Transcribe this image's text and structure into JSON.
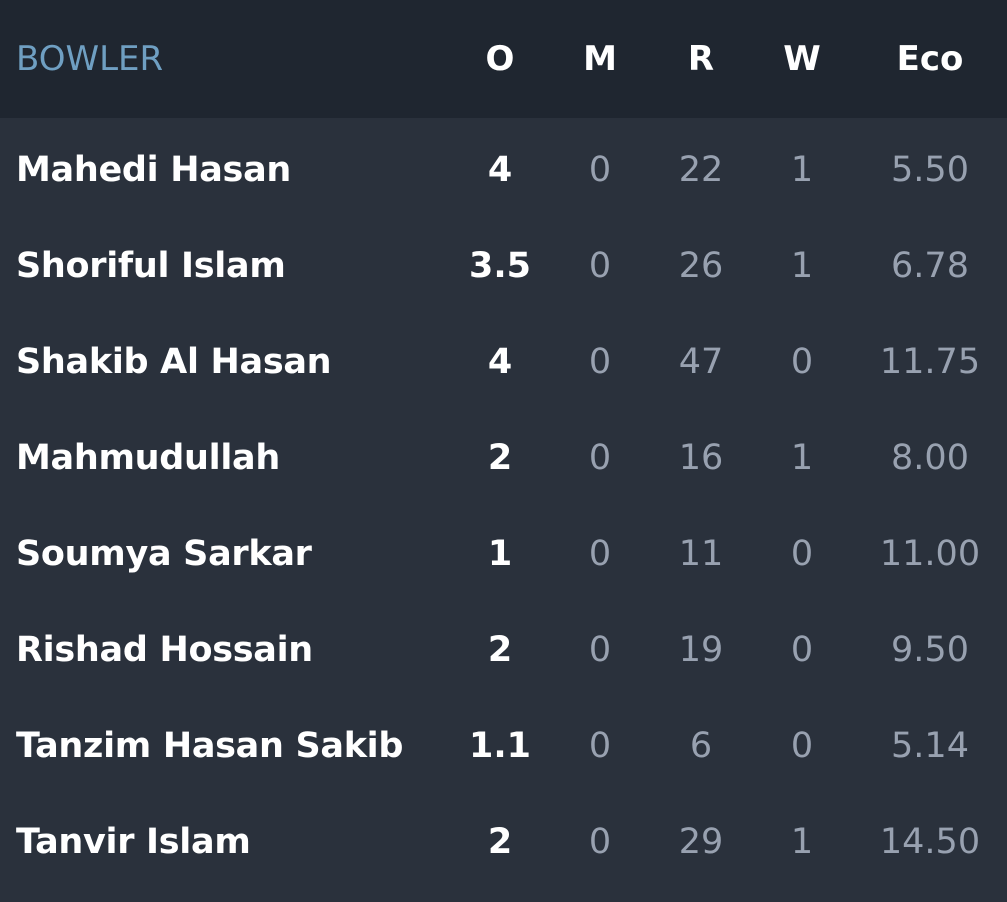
{
  "header": {
    "bowler_label": "BOWLER",
    "overs_label": "O",
    "maidens_label": "M",
    "runs_label": "R",
    "wickets_label": "W",
    "economy_label": "Eco"
  },
  "bowlers": [
    {
      "name": "Mahedi Hasan",
      "overs": "4",
      "maidens": "0",
      "runs": "22",
      "wickets": "1",
      "economy": "5.50"
    },
    {
      "name": "Shoriful Islam",
      "overs": "3.5",
      "maidens": "0",
      "runs": "26",
      "wickets": "1",
      "economy": "6.78"
    },
    {
      "name": "Shakib Al Hasan",
      "overs": "4",
      "maidens": "0",
      "runs": "47",
      "wickets": "0",
      "economy": "11.75"
    },
    {
      "name": "Mahmudullah",
      "overs": "2",
      "maidens": "0",
      "runs": "16",
      "wickets": "1",
      "economy": "8.00"
    },
    {
      "name": "Soumya Sarkar",
      "overs": "1",
      "maidens": "0",
      "runs": "11",
      "wickets": "0",
      "economy": "11.00"
    },
    {
      "name": "Rishad Hossain",
      "overs": "2",
      "maidens": "0",
      "runs": "19",
      "wickets": "0",
      "economy": "9.50"
    },
    {
      "name": "Tanzim Hasan Sakib",
      "overs": "1.1",
      "maidens": "0",
      "runs": "6",
      "wickets": "0",
      "economy": "5.14"
    },
    {
      "name": "Tanvir Islam",
      "overs": "2",
      "maidens": "0",
      "runs": "29",
      "wickets": "1",
      "economy": "14.50"
    }
  ],
  "colors": {
    "header_bg": "#1f2630",
    "body_bg": "#2a313c",
    "header_label": "#6f9fc2",
    "primary_text": "#ffffff",
    "muted_text": "#98a1b0"
  }
}
